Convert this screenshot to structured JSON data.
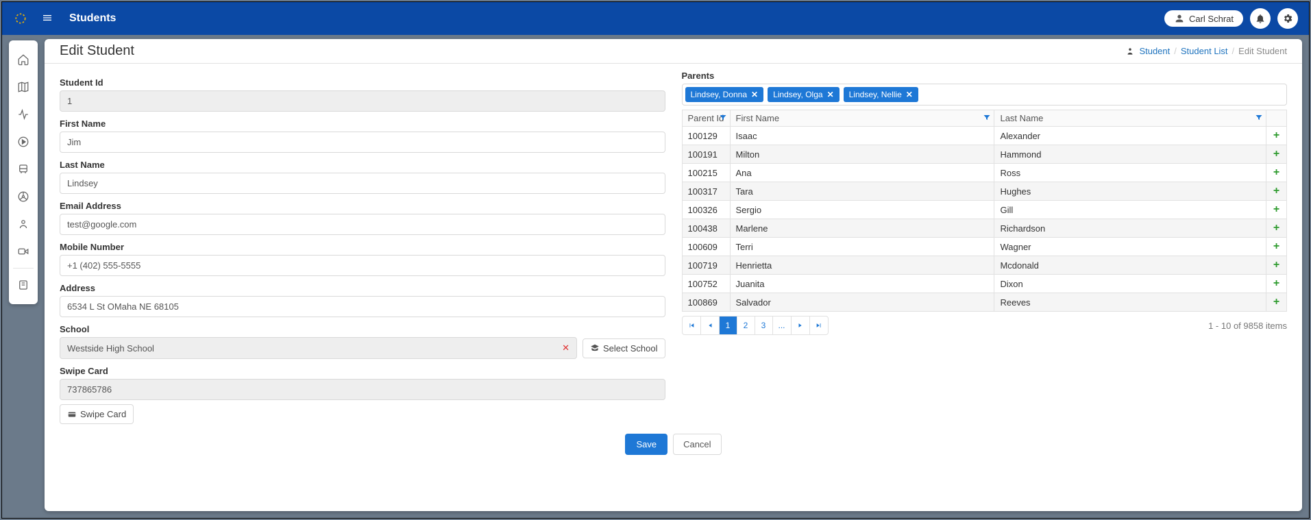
{
  "header": {
    "title": "Students",
    "user_name": "Carl Schrat"
  },
  "page": {
    "title": "Edit Student"
  },
  "breadcrumb": {
    "root": "Student",
    "list": "Student List",
    "current": "Edit Student"
  },
  "labels": {
    "student_id": "Student Id",
    "first_name": "First Name",
    "last_name": "Last Name",
    "email": "Email Address",
    "mobile": "Mobile Number",
    "address": "Address",
    "school": "School",
    "select_school_btn": "Select School",
    "swipe_card": "Swipe Card",
    "swipe_card_btn": "Swipe Card",
    "parents": "Parents",
    "save": "Save",
    "cancel": "Cancel"
  },
  "student": {
    "id": "1",
    "first_name": "Jim",
    "last_name": "Lindsey",
    "email": "test@google.com",
    "mobile": "+1 (402) 555-5555",
    "address": "6534 L St OMaha NE 68105",
    "school": "Westside High School",
    "swipe_card": "737865786"
  },
  "parents_selected": [
    "Lindsey, Donna",
    "Lindsey, Olga",
    "Lindsey, Nellie"
  ],
  "parents_columns": {
    "parent_id": "Parent Id",
    "first_name": "First Name",
    "last_name": "Last Name"
  },
  "parents_rows": [
    {
      "id": "100129",
      "first": "Isaac",
      "last": "Alexander"
    },
    {
      "id": "100191",
      "first": "Milton",
      "last": "Hammond"
    },
    {
      "id": "100215",
      "first": "Ana",
      "last": "Ross"
    },
    {
      "id": "100317",
      "first": "Tara",
      "last": "Hughes"
    },
    {
      "id": "100326",
      "first": "Sergio",
      "last": "Gill"
    },
    {
      "id": "100438",
      "first": "Marlene",
      "last": "Richardson"
    },
    {
      "id": "100609",
      "first": "Terri",
      "last": "Wagner"
    },
    {
      "id": "100719",
      "first": "Henrietta",
      "last": "Mcdonald"
    },
    {
      "id": "100752",
      "first": "Juanita",
      "last": "Dixon"
    },
    {
      "id": "100869",
      "first": "Salvador",
      "last": "Reeves"
    }
  ],
  "pager": {
    "p1": "1",
    "p2": "2",
    "p3": "3",
    "ellipsis": "...",
    "info": "1 - 10 of 9858 items"
  }
}
